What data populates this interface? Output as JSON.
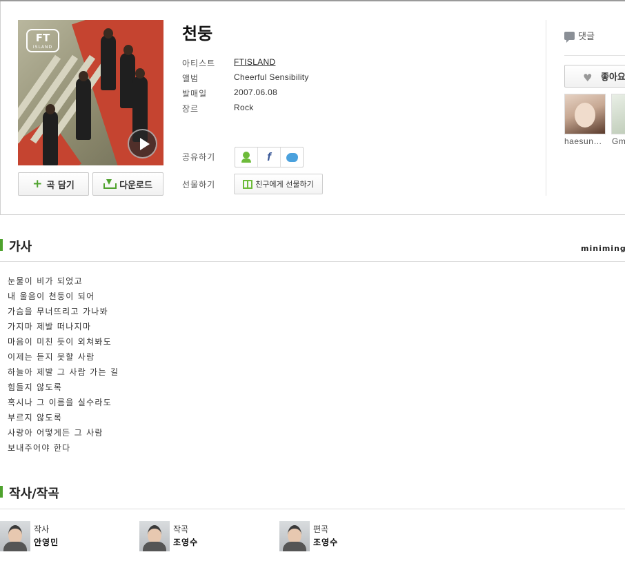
{
  "song": {
    "title": "천둥",
    "artist_label": "아티스트",
    "artist": "FTISLAND",
    "album_label": "앨범",
    "album": "Cheerful Sensibility",
    "release_label": "발매일",
    "release_date": "2007.06.08",
    "genre_label": "장르",
    "genre": "Rock"
  },
  "album_art": {
    "logo_text": "FT",
    "logo_sub": "ISLAND"
  },
  "actions": {
    "add_label": "곡 담기",
    "download_label": "다운로드",
    "share_label": "공유하기",
    "gift_row_label": "선물하기",
    "gift_button_label": "친구에게 선물하기"
  },
  "side": {
    "comment_label": "댓글",
    "like_label": "좋아요",
    "fans": [
      {
        "name": "haesun…"
      },
      {
        "name": "Gm"
      }
    ]
  },
  "lyrics_section": {
    "title": "가사",
    "user": "miniming",
    "lines": [
      "눈물이 비가 되었고",
      "내 울음이 천둥이 되어",
      "가슴을 무너뜨리고 가나봐",
      "가지마 제발 떠나지마",
      "마음이 미친 듯이 외쳐봐도",
      "이제는 듣지 못할 사람",
      "하늘아 제발 그 사람 가는 길",
      "힘들지 않도록",
      "혹시나 그 이름을 실수라도",
      "부르지 않도록",
      "사랑아 어떻게든 그 사람",
      "보내주어야 한다"
    ]
  },
  "credits_section": {
    "title": "작사/작곡",
    "credits": [
      {
        "role": "작사",
        "name": "안영민"
      },
      {
        "role": "작곡",
        "name": "조영수"
      },
      {
        "role": "편곡",
        "name": "조영수"
      }
    ]
  },
  "colors": {
    "accent": "#4ea22d",
    "facebook": "#3b5998",
    "twitter": "#4aa1dd"
  }
}
